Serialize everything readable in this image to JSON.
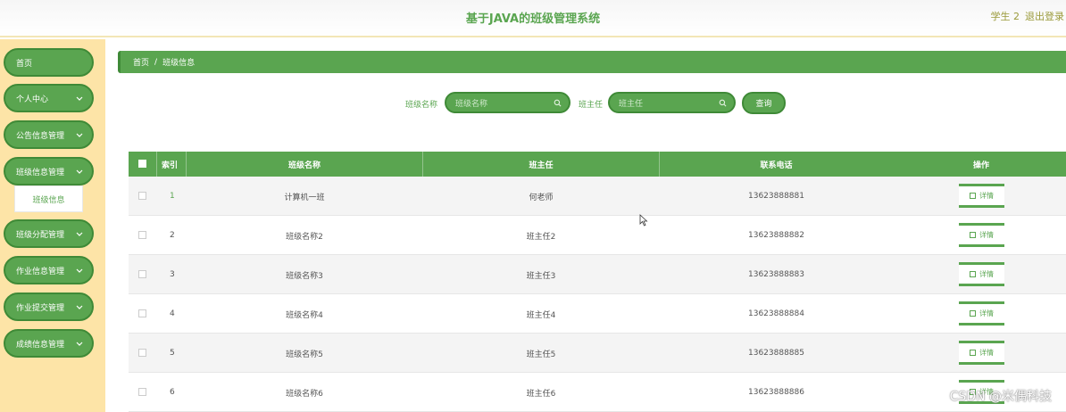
{
  "header": {
    "title": "基于JAVA的班级管理系统",
    "user": "学生 2",
    "logout": "退出登录"
  },
  "sidebar": {
    "items": [
      {
        "label": "首页",
        "has_chevron": false
      },
      {
        "label": "个人中心",
        "has_chevron": true
      },
      {
        "label": "公告信息管理",
        "has_chevron": true
      },
      {
        "label": "班级信息管理",
        "has_chevron": true
      },
      {
        "label": "班级分配管理",
        "has_chevron": true
      },
      {
        "label": "作业信息管理",
        "has_chevron": true
      },
      {
        "label": "作业提交管理",
        "has_chevron": true
      },
      {
        "label": "成绩信息管理",
        "has_chevron": true
      }
    ],
    "subitem": "班级信息"
  },
  "breadcrumb": {
    "home": "首页",
    "separator": "/",
    "current": "班级信息"
  },
  "search": {
    "class_label": "班级名称",
    "class_placeholder": "班级名称",
    "teacher_label": "班主任",
    "teacher_placeholder": "班主任",
    "button": "查询"
  },
  "table": {
    "headers": [
      "索引",
      "班级名称",
      "班主任",
      "联系电话",
      "操作"
    ],
    "rows": [
      {
        "index": "1",
        "name": "计算机一班",
        "teacher": "何老师",
        "phone": "13623888881",
        "action": "详情"
      },
      {
        "index": "2",
        "name": "班级名称2",
        "teacher": "班主任2",
        "phone": "13623888882",
        "action": "详情"
      },
      {
        "index": "3",
        "name": "班级名称3",
        "teacher": "班主任3",
        "phone": "13623888883",
        "action": "详情"
      },
      {
        "index": "4",
        "name": "班级名称4",
        "teacher": "班主任4",
        "phone": "13623888884",
        "action": "详情"
      },
      {
        "index": "5",
        "name": "班级名称5",
        "teacher": "班主任5",
        "phone": "13623888885",
        "action": "详情"
      },
      {
        "index": "6",
        "name": "班级名称6",
        "teacher": "班主任6",
        "phone": "13623888886",
        "action": "详情"
      }
    ]
  },
  "watermark": "CSDN @米偶科技",
  "colors": {
    "accent": "#5aa550",
    "accent_dark": "#3f8a37",
    "sidebar_bg": "#fde4a7",
    "row_alt": "#f4f4f4"
  }
}
